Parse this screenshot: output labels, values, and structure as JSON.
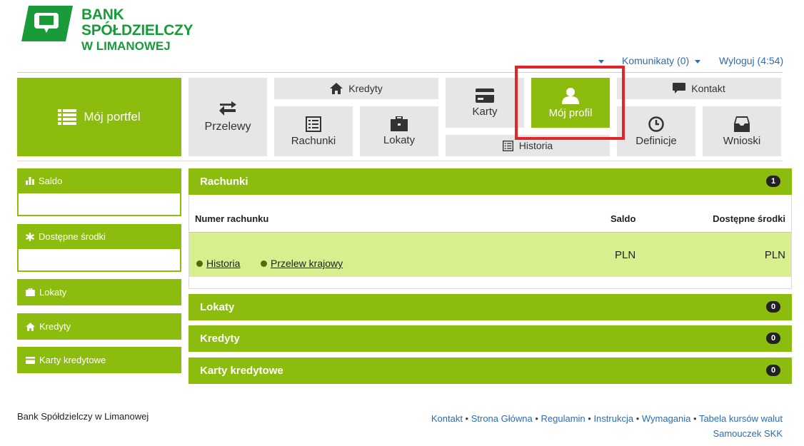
{
  "brand": {
    "line1": "BANK SPÓŁDZIELCZY",
    "line2": "W LIMANOWEJ",
    "color": "#1a9b3a"
  },
  "topbar": {
    "messages": "Komunikaty (0)",
    "logout": "Wyloguj (4:54)"
  },
  "nav": {
    "portfolio": "Mój portfel",
    "transfers": "Przelewy",
    "credits": "Kredyty",
    "accounts": "Rachunki",
    "deposits": "Lokaty",
    "cards": "Karty",
    "history": "Historia",
    "profile": "Mój profil",
    "contact": "Kontakt",
    "definitions": "Definicje",
    "requests": "Wnioski"
  },
  "sidebar": {
    "balance": "Saldo",
    "available": "Dostępne środki",
    "deposits": "Lokaty",
    "credits": "Kredyty",
    "credit_cards": "Karty kredytowe"
  },
  "panels": {
    "accounts": {
      "title": "Rachunki",
      "count": "1"
    },
    "deposits": {
      "title": "Lokaty",
      "count": "0"
    },
    "credits": {
      "title": "Kredyty",
      "count": "0"
    },
    "cards": {
      "title": "Karty kredytowe",
      "count": "0"
    }
  },
  "table": {
    "col_number": "Numer rachunku",
    "col_balance": "Saldo",
    "col_available": "Dostępne środki",
    "row": {
      "link_history": "Historia",
      "link_transfer": "Przelew krajowy",
      "balance": "PLN",
      "available": "PLN"
    }
  },
  "footer": {
    "bank_name": "Bank Spółdzielczy w Limanowej",
    "links": [
      "Kontakt",
      "Strona Główna",
      "Regulamin",
      "Instrukcja",
      "Wymagania",
      "Tabela kursów walut",
      "Samouczek SKK"
    ],
    "separator": " • "
  },
  "colors": {
    "accent": "#8cbd0e",
    "tile": "#e6e6e6",
    "link": "#2d6cb3",
    "highlight": "#e0262a",
    "row": "#d8ef8f"
  }
}
